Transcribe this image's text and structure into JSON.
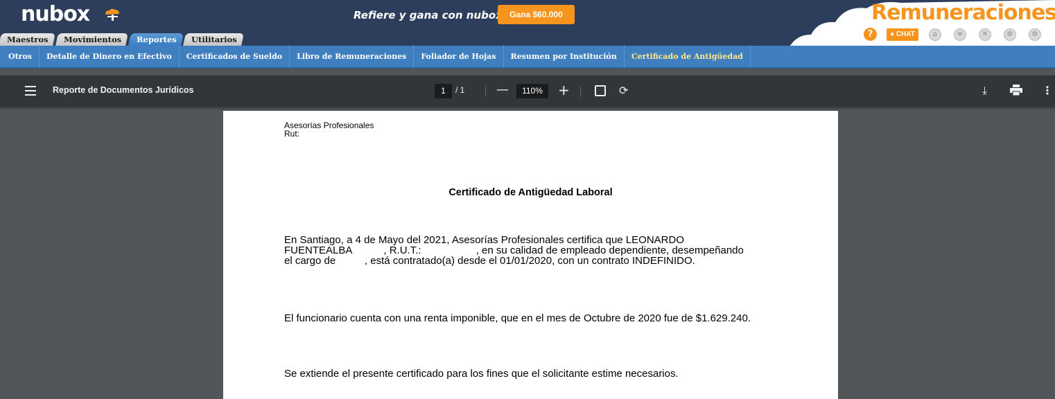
{
  "header": {
    "logo": "nubox",
    "promo_text": "Refiere y gana con nubox",
    "promo_button": "Gana $60.000",
    "brand": "Remuneraciones",
    "chat_label": "CHAT",
    "help_label": "?",
    "tabs": [
      {
        "label": "Maestros",
        "active": false
      },
      {
        "label": "Movimientos",
        "active": false
      },
      {
        "label": "Reportes",
        "active": true
      },
      {
        "label": "Utilitarios",
        "active": false
      }
    ]
  },
  "subnav": {
    "items": [
      {
        "label": "Otros"
      },
      {
        "label": "Detalle de Dinero en Efectivo"
      },
      {
        "label": "Certificados de Sueldo"
      },
      {
        "label": "Libro de Remuneraciones"
      },
      {
        "label": "Foliador de Hojas"
      },
      {
        "label": "Resumen por Institución"
      },
      {
        "label": "Certificado de Antigüedad"
      }
    ],
    "active_index": 6
  },
  "pdf_viewer": {
    "title": "Reporte de Documentos Jurídicos",
    "current_page": "1",
    "total_pages": "/ 1",
    "zoom": "110%"
  },
  "document": {
    "company": "Asesorías Profesionales",
    "rut_label": "Rut:",
    "title": "Certificado de Antigüedad Laboral",
    "paragraph1_line1": "En Santiago, a 4 de Mayo del 2021, Asesorías Profesionales certifica que LEONARDO",
    "paragraph1_line2": "FUENTEALBA           , R.U.T.:                   , en su calidad de empleado dependiente, desempeñando",
    "paragraph1_line3": "el cargo de          , está contratado(a) desde el 01/01/2020, con un contrato INDEFINIDO.",
    "paragraph2": "El funcionario cuenta con una renta imponible, que en el mes de Octubre de 2020 fue de $1.629.240.",
    "paragraph3": "Se extiende el presente certificado para los fines que el solicitante estime necesarios."
  },
  "colors": {
    "header_bg": "#2c3e5c",
    "accent": "#f7941d",
    "subnav_bg": "#3f7fbf",
    "active_subnav_text": "#ffe88a",
    "viewer_bg": "#525659",
    "viewer_toolbar": "#323639"
  }
}
